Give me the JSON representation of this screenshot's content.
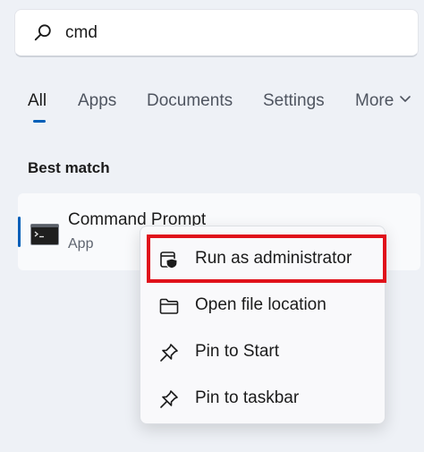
{
  "search": {
    "query": "cmd",
    "icon": "search-icon"
  },
  "tabs": [
    {
      "label": "All",
      "active": true
    },
    {
      "label": "Apps"
    },
    {
      "label": "Documents"
    },
    {
      "label": "Settings"
    },
    {
      "label": "More"
    }
  ],
  "best_match": {
    "section_title": "Best match",
    "name": "Command Prompt",
    "type": "App",
    "icon": "command-prompt-icon"
  },
  "context_menu": {
    "items": [
      {
        "label": "Run as administrator",
        "icon": "shield-icon",
        "highlighted": true
      },
      {
        "label": "Open file location",
        "icon": "folder-icon"
      },
      {
        "label": "Pin to Start",
        "icon": "pin-icon"
      },
      {
        "label": "Pin to taskbar",
        "icon": "pin-icon"
      }
    ]
  },
  "colors": {
    "background": "#eef1f6",
    "accent": "#005fb8",
    "highlight_border": "#e0121b",
    "menu_background": "#f9f9fb"
  }
}
